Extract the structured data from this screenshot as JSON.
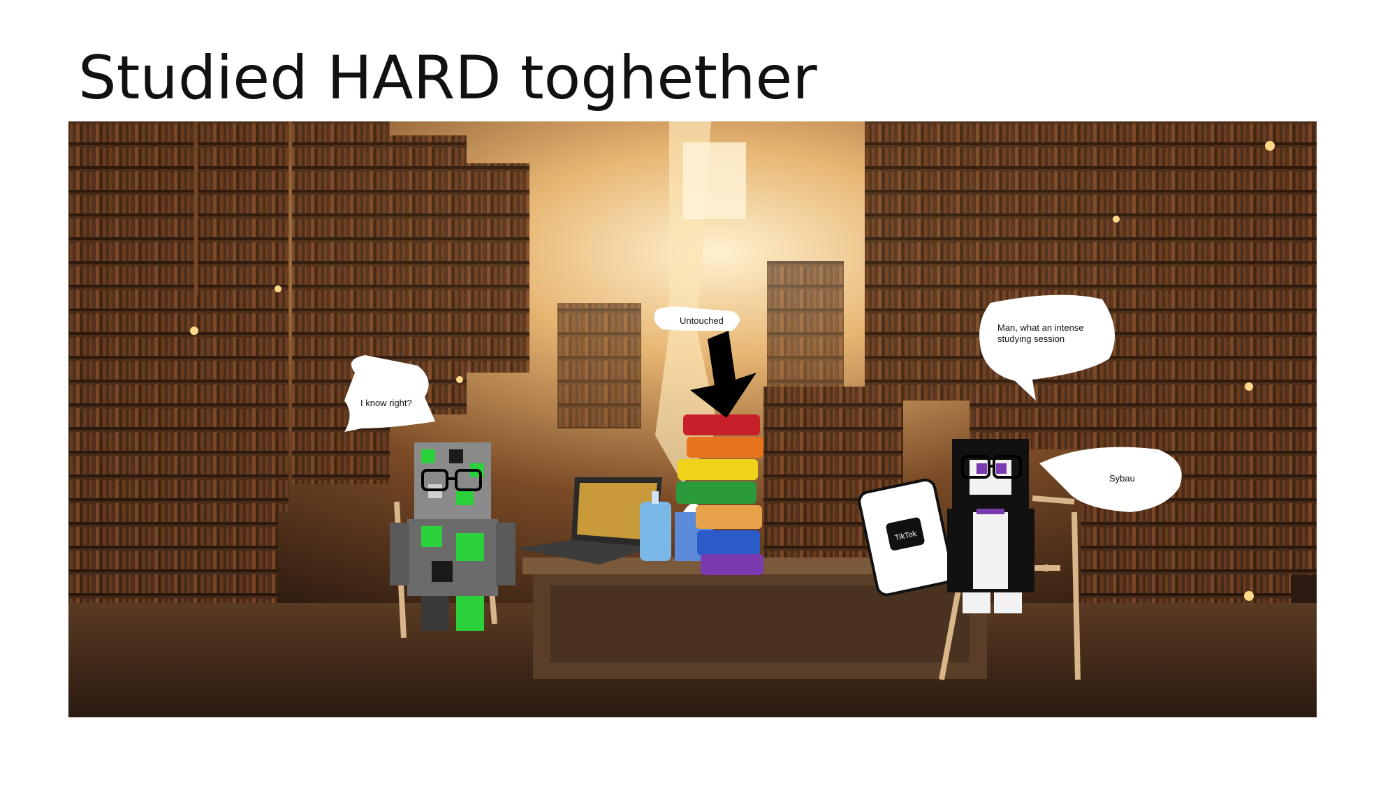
{
  "slide": {
    "title": "Studied HARD toghether"
  },
  "bubbles": {
    "left": "I know right?",
    "books": "Untouched",
    "right_top_line1": "Man, what an intense",
    "right_top_line2": "studying session",
    "right_bottom": "Sybau"
  },
  "phone": {
    "app_label": "TikTok"
  },
  "colors": {
    "background": "#ffffff",
    "scene_dark": "#2b1a10",
    "scene_glow": "#f3c27a",
    "book_red": "#c8202a",
    "book_orange": "#e8731f",
    "book_yellow": "#f0d21a",
    "book_green": "#2a9a3a",
    "book_blue": "#2a5bc8",
    "book_purple": "#7a3bb0",
    "skin_green": "#2bd13a"
  },
  "icons": [
    "arrow-down-icon",
    "tiktok-icon",
    "glasses-icon"
  ]
}
